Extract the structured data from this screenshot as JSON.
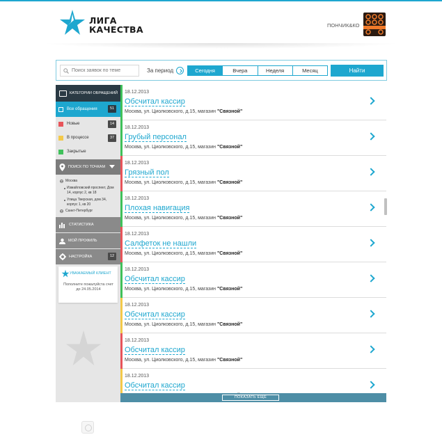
{
  "header": {
    "logo_line1": "ЛИГА",
    "logo_line2": "КАЧЕСТВА",
    "user_name": "ПОНЧИК&КО",
    "avatar_text": "ПОНЧИК&КО"
  },
  "search": {
    "placeholder": "Поиск заявок по теме",
    "period_label": "За период",
    "periods": [
      "Сегодня",
      "Вчера",
      "Неделя",
      "Месяц"
    ],
    "selected_period": "Сегодня",
    "find_label": "Найти"
  },
  "sidebar": {
    "categories_label": "КАТЕГОРИИ ОБРАЩЕНИЙ",
    "all_label": "Все обращения",
    "all_count": "51",
    "statuses": [
      {
        "label": "Новые",
        "count": "14",
        "color": "#e8545a"
      },
      {
        "label": "В процессе",
        "count": "37",
        "color": "#f3c94a"
      },
      {
        "label": "Закрытые",
        "count": "",
        "color": "#3fc15a"
      }
    ],
    "points_label": "ПОИСК ПО ТОЧКАМ",
    "cities": {
      "moscow": "Москва",
      "addr1": "Измайловский проспект, Дом 14, корпус 2, кв 18",
      "addr2": "Улица Тверская, дом 34, корпус 1, кв 20",
      "spb": "Санкт-Петербург"
    },
    "stats_label": "СТАТИСТИКА",
    "profile_label": "МОЙ ПРОФИЛЬ",
    "settings_label": "НАСТРОЙКА",
    "settings_count": "12",
    "notice_title": "УВАЖАЕМЫЙ КЛИЕНТ",
    "notice_text": "Пополните пожалуйста счет до 24.05.2014"
  },
  "list": {
    "items": [
      {
        "date": "18.12.2013",
        "title": "Обсчитал кассир",
        "place": "Москва, ул. Циолковского, д.15, магазин",
        "shop": "\"Связной\"",
        "color": "#3fc15a"
      },
      {
        "date": "18.12.2013",
        "title": "Грубый персонал",
        "place": "Москва, ул. Циолковского, д.15, магазин",
        "shop": "\"Связной\"",
        "color": "#3fc15a"
      },
      {
        "date": "18.12.2013",
        "title": "Грязный пол",
        "place": "Москва, ул. Циолковского, д.15, магазин",
        "shop": "\"Связной\"",
        "color": "#e8545a"
      },
      {
        "date": "18.12.2013",
        "title": "Плохая навигация",
        "place": "Москва, ул. Циолковского, д.15, магазин",
        "shop": "\"Связной\"",
        "color": "#3fc15a"
      },
      {
        "date": "18.12.2013",
        "title": "Салфеток не нашли",
        "place": "Москва, ул. Циолковского, д.15, магазин",
        "shop": "\"Связной\"",
        "color": "#e8545a"
      },
      {
        "date": "18.12.2013",
        "title": "Обсчитал кассир",
        "place": "Москва, ул. Циолковского, д.15, магазин",
        "shop": "\"Связной\"",
        "color": "#3fc15a"
      },
      {
        "date": "18.12.2013",
        "title": "Обсчитал кассир",
        "place": "Москва, ул. Циолковского, д.15, магазин",
        "shop": "\"Связной\"",
        "color": "#f3c94a"
      },
      {
        "date": "18.12.2013",
        "title": "Обсчитал кассир",
        "place": "Москва, ул. Циолковского, д.15, магазин",
        "shop": "\"Связной\"",
        "color": "#e8545a"
      },
      {
        "date": "18.12.2013",
        "title": "Обсчитал кассир",
        "place": "Москва, ул. Циолковского, д.15, магазин",
        "shop": "\"Связной\"",
        "color": "#f3c94a"
      }
    ],
    "more_label": "ПОКАЗАТЬ ЕЩЕ"
  }
}
